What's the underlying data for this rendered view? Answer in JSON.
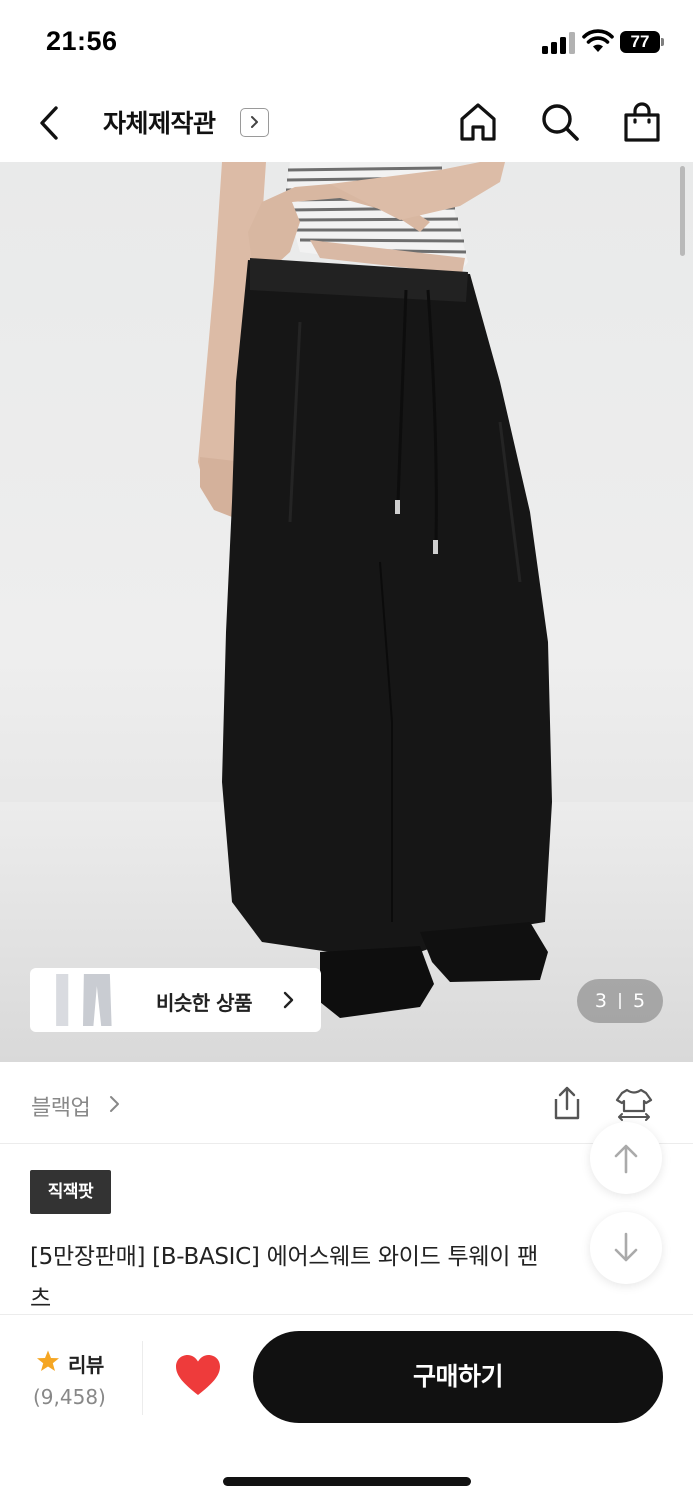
{
  "status_bar": {
    "time": "21:56",
    "battery": "77",
    "icons": [
      "cellular-signal-icon",
      "wifi-icon",
      "battery-icon"
    ]
  },
  "nav": {
    "title": "자체제작관",
    "icons": [
      "back-chevron-icon",
      "chevron-right-box-icon",
      "home-icon",
      "search-icon",
      "shopping-bag-icon"
    ]
  },
  "gallery": {
    "current": "3",
    "total": "5",
    "similar_label": "비슷한 상품",
    "similar_thumb_icon": "pants-thumbnail-icon"
  },
  "brand": {
    "name": "블랙업",
    "icons": [
      "share-icon",
      "clothing-fit-icon"
    ]
  },
  "floating": {
    "icons": [
      "arrow-up-icon",
      "arrow-down-icon"
    ]
  },
  "product": {
    "badge": "직잭팟",
    "title_line1": "[5만장판매] [B-BASIC] 에어스웨트 와이드 투웨이 팬",
    "title_line2": "츠"
  },
  "bottom_bar": {
    "review_label": "리뷰",
    "review_count": "(9,458)",
    "buy_label": "구매하기"
  },
  "colors": {
    "accent_star": "#f5a623",
    "heart": "#ee3b3b",
    "buy_button": "#111111",
    "badge": "#333333"
  }
}
